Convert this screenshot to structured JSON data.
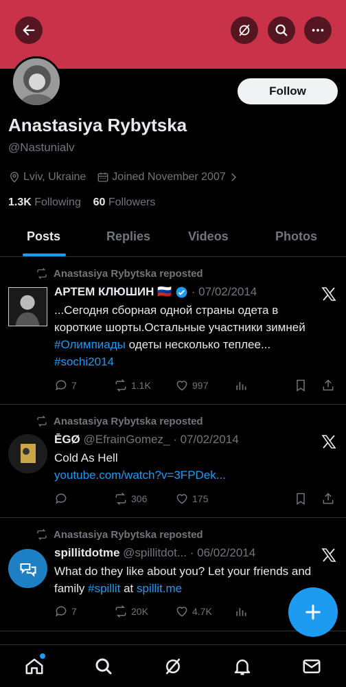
{
  "header": {
    "back_icon": "arrow-left-icon",
    "grok_icon": "slash-circle-icon",
    "search_icon": "search-icon",
    "more_icon": "more-horizontal-icon",
    "banner_color": "#c8334a"
  },
  "profile": {
    "name": "Anastasiya Rybytska",
    "handle": "@Nastunialv",
    "location": "Lviv, Ukraine",
    "joined": "Joined November 2007",
    "following_count": "1.3K",
    "following_label": "Following",
    "followers_count": "60",
    "followers_label": "Followers",
    "follow_button": "Follow"
  },
  "tabs": [
    {
      "label": "Posts",
      "active": true
    },
    {
      "label": "Replies"
    },
    {
      "label": "Videos"
    },
    {
      "label": "Photos"
    }
  ],
  "posts": [
    {
      "repost_label": "Anastasiya Rybytska reposted",
      "author": "АРТЕМ КЛЮШИН",
      "flag": "🇷🇺",
      "date": "· 07/02/2014",
      "text1": "...Сегодня сборная одной страны одета  в короткие шорты.Остальные участники зимней ",
      "hashtag1": "#Олимпиады",
      "text2": " одеты несколько теплее... ",
      "hashtag2": "#sochi2014",
      "replies": "7",
      "reposts": "1.1K",
      "likes": "997"
    },
    {
      "repost_label": "Anastasiya Rybytska reposted",
      "author": "ĒGØ",
      "author_handle": "@EfrainGomez_",
      "date": "· 07/02/2014",
      "text": "Cold As Hell",
      "link": "youtube.com/watch?v=3FPDek...",
      "reposts": "306",
      "likes": "175"
    },
    {
      "repost_label": "Anastasiya Rybytska reposted",
      "author": "spillitdotme",
      "author_handle": "@spillitdot...",
      "date": "· 06/02/2014",
      "text1": "What do they like about you? Let your friends and family ",
      "hashtag": "#spillit",
      "text2": " at ",
      "link": "spillit.me",
      "replies": "7",
      "reposts": "20K",
      "likes": "4.7K"
    }
  ],
  "bottom_nav": [
    "home-icon",
    "search-icon",
    "grok-icon",
    "notifications-icon",
    "messages-icon"
  ],
  "accent": "#1d9bf0"
}
